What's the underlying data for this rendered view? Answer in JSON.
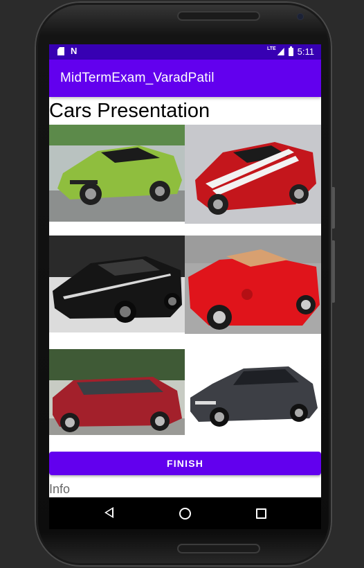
{
  "status_bar": {
    "time": "5:11",
    "network": "LTE"
  },
  "app_bar": {
    "title": "MidTermExam_VaradPatil"
  },
  "main": {
    "heading": "Cars Presentation",
    "cars": [
      {
        "name": "car-lime-green-supercar",
        "color": "#8fbe3e"
      },
      {
        "name": "car-red-striped-sportscar",
        "color": "#c4161c"
      },
      {
        "name": "car-black-supercar",
        "color": "#151515"
      },
      {
        "name": "car-red-convertible",
        "color": "#e0141b"
      },
      {
        "name": "car-red-suv",
        "color": "#a3202b"
      },
      {
        "name": "car-gray-sedan",
        "color": "#3d3f45"
      }
    ],
    "finish_label": "FINISH",
    "info_label": "Info"
  }
}
